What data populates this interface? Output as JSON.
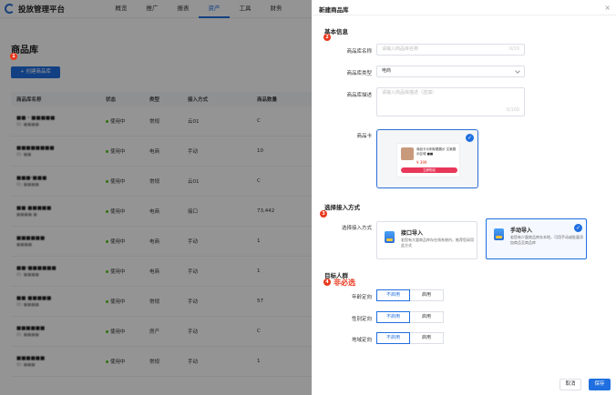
{
  "app": {
    "title": "投放管理平台",
    "nav": [
      "概览",
      "推广",
      "报表",
      "资产",
      "工具",
      "财务"
    ],
    "active_nav_index": 3
  },
  "page": {
    "title": "商品库",
    "create_button": "+ 创建商品库",
    "table": {
      "headers": [
        "商品库名称",
        "状态",
        "类型",
        "接入方式",
        "商品数量"
      ],
      "rows": [
        {
          "name": "■■ · ■■■■■",
          "sub": "ID: ■■■■",
          "status": "使用中",
          "type": "常规",
          "mode": "云01",
          "count": "C"
        },
        {
          "name": "■■■■■■■■",
          "sub": "ID: ■■",
          "status": "使用中",
          "type": "电商",
          "mode": "手动",
          "count": "10"
        },
        {
          "name": "■■■·■■■",
          "sub": "ID: ■■■■",
          "status": "使用中",
          "type": "常规",
          "mode": "云01",
          "count": "C"
        },
        {
          "name": "■■ ■■■■■",
          "sub": "■■■■ ■",
          "status": "使用中",
          "type": "电商",
          "mode": "接口",
          "count": "73,442"
        },
        {
          "name": "■■■■■■",
          "sub": "■■■■",
          "status": "使用中",
          "type": "电商",
          "mode": "手动",
          "count": "1"
        },
        {
          "name": "■■·■■■■■■",
          "sub": "ID: ■■■■",
          "status": "使用中",
          "type": "电商",
          "mode": "手动",
          "count": "1"
        },
        {
          "name": "■■ ■■■■■",
          "sub": "ID: ■■■■",
          "status": "使用中",
          "type": "常规",
          "mode": "手动",
          "count": "57"
        },
        {
          "name": "■■■■■■",
          "sub": "ID: ■■■■",
          "status": "使用中",
          "type": "房产",
          "mode": "手动",
          "count": "C"
        },
        {
          "name": "■■■■■■",
          "sub": "ID: ■■■",
          "status": "使用中",
          "type": "常规",
          "mode": "手动",
          "count": "1"
        }
      ]
    }
  },
  "drawer": {
    "title": "新建商品库",
    "basic_section": "基本信息",
    "name_label": "商品库名称",
    "name_placeholder": "请输入商品库名称",
    "name_counter": "0/20",
    "type_label": "商品库类型",
    "type_value": "电商",
    "desc_label": "商品库描述",
    "desc_placeholder": "请输入商品库描述（选填）",
    "desc_counter": "0/100",
    "card_label": "商品卡",
    "card_preview": {
      "desc": "商品卡示例标题展示 文案展示区域 ■■",
      "price": "¥ 399",
      "button": "立即购买"
    },
    "access_section": "选择接入方式",
    "access_label": "选择接入方式",
    "modes": [
      {
        "title": "接口导入",
        "desc": "若您有大量商品库存在线系统内，推荐您采用此方式"
      },
      {
        "title": "手动导入",
        "desc": "若您有少量商品库存本地，可用手动或批量添加商品至商品库"
      }
    ],
    "audience_section": "目标人群",
    "annotation_optional": "非必选",
    "toggles": [
      {
        "label": "年龄定向",
        "off": "不启用",
        "on": "启用"
      },
      {
        "label": "性别定向",
        "off": "不启用",
        "on": "启用"
      },
      {
        "label": "地域定向",
        "off": "不启用",
        "on": "启用"
      }
    ],
    "cancel_button": "取消",
    "save_button": "保存"
  },
  "annotations": [
    "1",
    "2",
    "3",
    "4"
  ],
  "colors": {
    "primary": "#1f6fe0",
    "annotation_red": "#e8381d",
    "status_green": "#52c41a"
  }
}
